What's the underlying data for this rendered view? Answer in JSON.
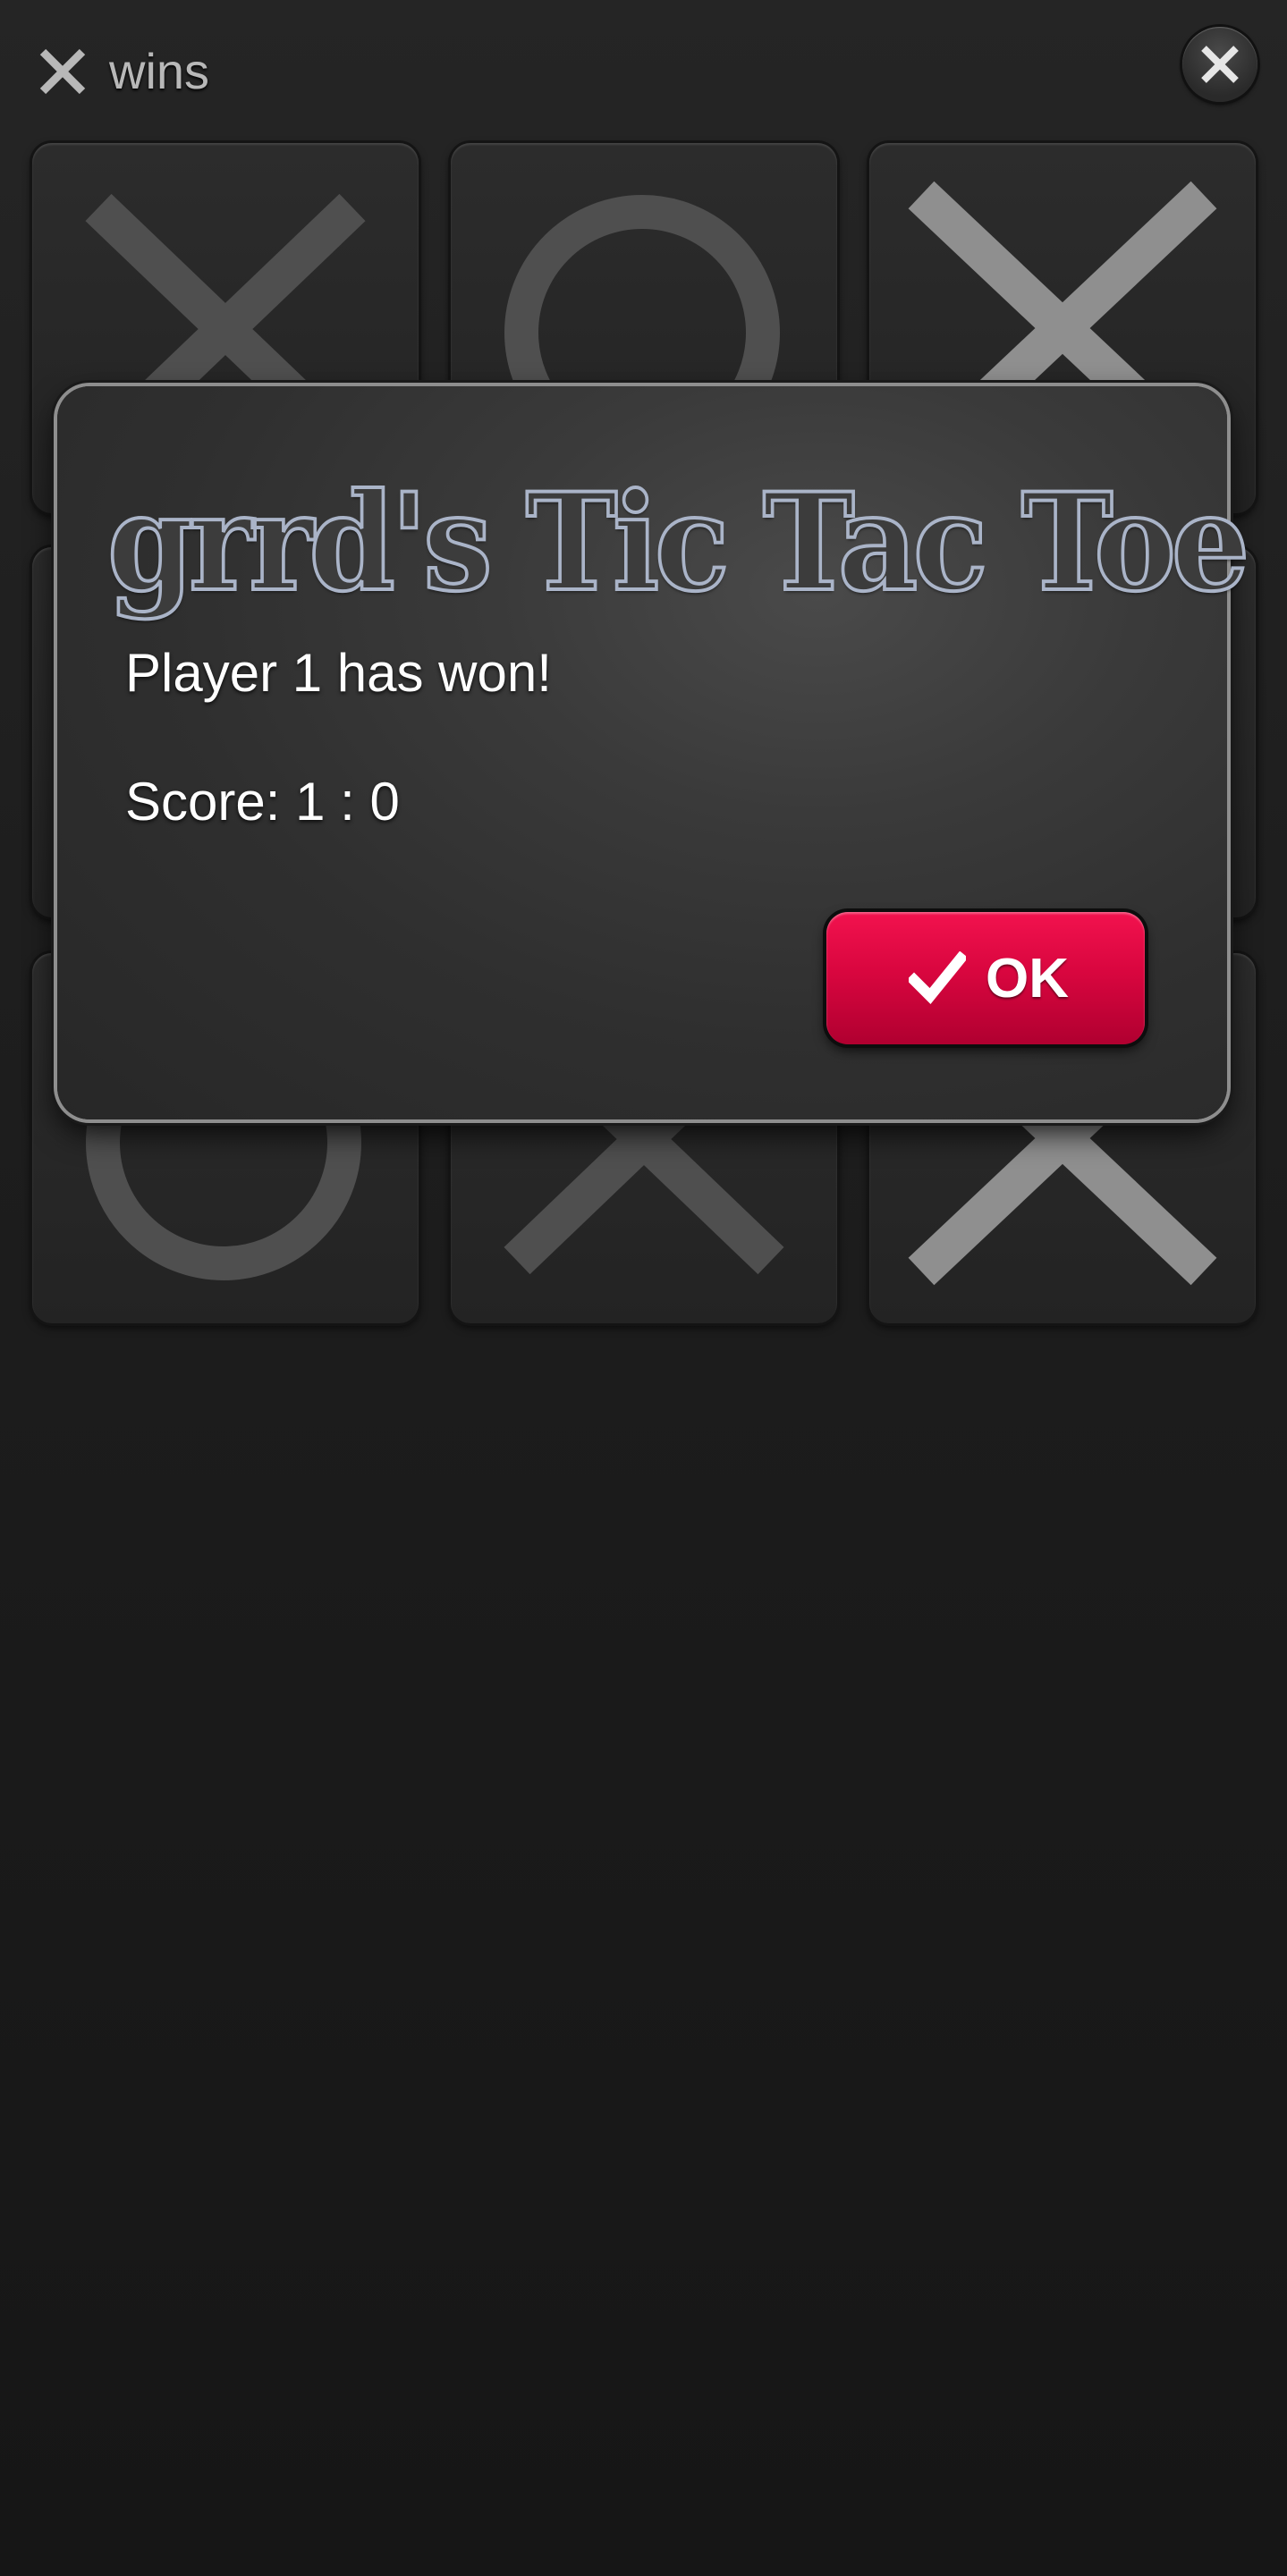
{
  "header": {
    "status_icon": "x-mark-icon",
    "status_text": "wins",
    "close_icon": "close-icon"
  },
  "board": {
    "cells": [
      "X",
      "O",
      "X",
      "",
      "",
      "",
      "O",
      "X",
      "X"
    ]
  },
  "dialog": {
    "title": "grrd's Tic Tac Toe",
    "message": "Player 1 has won!",
    "score": "Score: 1 : 0",
    "ok_icon": "checkmark-icon",
    "ok_label": "OK"
  },
  "colors": {
    "accent": "#d9063f",
    "title_outline": "#aab4c8",
    "mark_light": "#8f8f8f",
    "mark_dark": "#4f4f4f"
  }
}
